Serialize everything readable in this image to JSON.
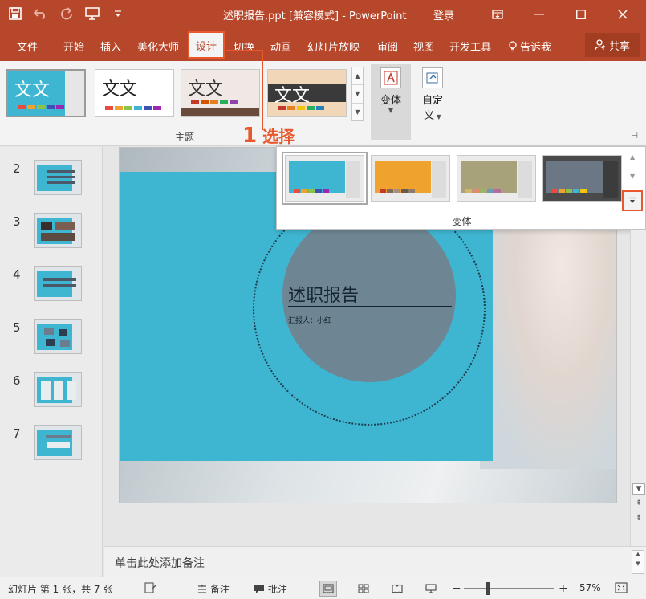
{
  "titlebar": {
    "title": "述职报告.ppt [兼容模式]  -  PowerPoint",
    "login": "登录"
  },
  "menu": {
    "items": [
      "文件",
      "开始",
      "插入",
      "美化大师",
      "设计",
      "切换",
      "动画",
      "幻灯片放映",
      "审阅",
      "视图",
      "开发工具",
      "告诉我"
    ],
    "active": "设计",
    "share": "共享"
  },
  "ribbon": {
    "themes": [
      {
        "word": "文文",
        "bg": "#3eb6d2"
      },
      {
        "word": "文文",
        "bg": "#ffffff"
      },
      {
        "word": "文文",
        "bg": "#efe8e4"
      },
      {
        "word": "文文",
        "bg": "#f1d7b8"
      }
    ],
    "theme_group_label": "主题",
    "variant_button": "变体",
    "custom_button_line1": "自定",
    "custom_button_line2": "义"
  },
  "annotation": {
    "number": "1",
    "text": "选择"
  },
  "variants": {
    "label": "变体",
    "items": [
      {
        "main": "#3eb6d2"
      },
      {
        "main": "#f0a22e"
      },
      {
        "main": "#a8a27a"
      },
      {
        "main": "#6b7785"
      }
    ]
  },
  "slides": {
    "numbers": [
      "2",
      "3",
      "4",
      "5",
      "6",
      "7"
    ]
  },
  "slide": {
    "title": "述职报告",
    "subtitle": "汇报人：小红"
  },
  "notes": {
    "placeholder": "单击此处添加备注"
  },
  "status": {
    "slide_info": "幻灯片 第 1 张，共 7 张",
    "notes_btn": "备注",
    "comments_btn": "批注",
    "zoom": "57%"
  },
  "colors": {
    "accent": "#b7472a",
    "highlight": "#e8582c",
    "slide_cyan": "#3eb6d2"
  }
}
